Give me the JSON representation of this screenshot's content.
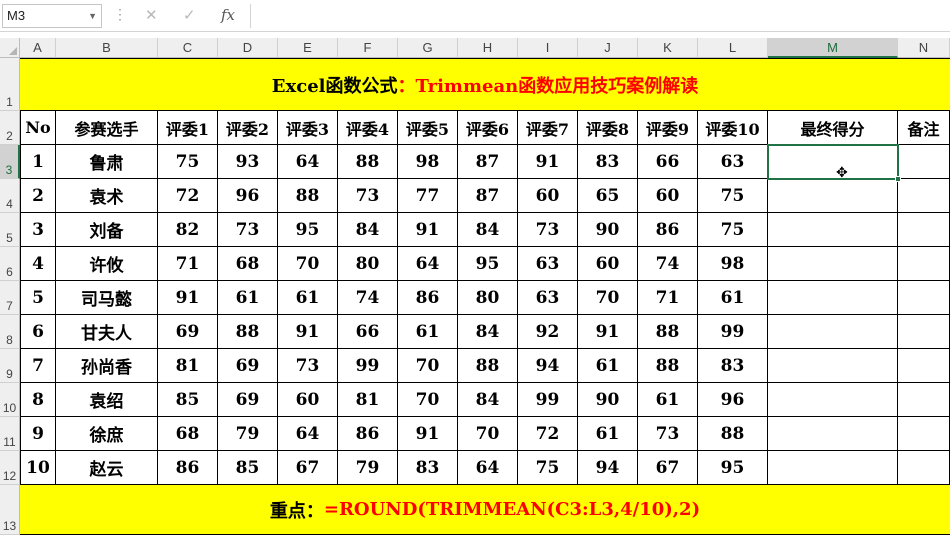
{
  "formula_bar": {
    "name_box": "M3",
    "name_box_arrow": "▼",
    "separator": "⋮",
    "cancel_icon": "✕",
    "enter_icon": "✓",
    "fx_label": "fx",
    "formula": ""
  },
  "columns": [
    "A",
    "B",
    "C",
    "D",
    "E",
    "F",
    "G",
    "H",
    "I",
    "J",
    "K",
    "L",
    "M",
    "N"
  ],
  "rows": [
    "1",
    "2",
    "3",
    "4",
    "5",
    "6",
    "7",
    "8",
    "9",
    "10",
    "11",
    "12",
    "13"
  ],
  "active_cell": "M3",
  "title": {
    "part1": "Excel函数公式",
    "part2": "：Trimmean函数应用技巧案例解读"
  },
  "table": {
    "headers": [
      "No",
      "参赛选手",
      "评委1",
      "评委2",
      "评委3",
      "评委4",
      "评委5",
      "评委6",
      "评委7",
      "评委8",
      "评委9",
      "评委10",
      "最终得分",
      "备注"
    ],
    "rows": [
      [
        "1",
        "鲁肃",
        "75",
        "93",
        "64",
        "88",
        "98",
        "87",
        "91",
        "83",
        "66",
        "63",
        "",
        ""
      ],
      [
        "2",
        "袁术",
        "72",
        "96",
        "88",
        "73",
        "77",
        "87",
        "60",
        "65",
        "60",
        "75",
        "",
        ""
      ],
      [
        "3",
        "刘备",
        "82",
        "73",
        "95",
        "84",
        "91",
        "84",
        "73",
        "90",
        "86",
        "75",
        "",
        ""
      ],
      [
        "4",
        "许攸",
        "71",
        "68",
        "70",
        "80",
        "64",
        "95",
        "63",
        "60",
        "74",
        "98",
        "",
        ""
      ],
      [
        "5",
        "司马懿",
        "91",
        "61",
        "61",
        "74",
        "86",
        "80",
        "63",
        "70",
        "71",
        "61",
        "",
        ""
      ],
      [
        "6",
        "甘夫人",
        "69",
        "88",
        "91",
        "66",
        "61",
        "84",
        "92",
        "91",
        "88",
        "99",
        "",
        ""
      ],
      [
        "7",
        "孙尚香",
        "81",
        "69",
        "73",
        "99",
        "70",
        "88",
        "94",
        "61",
        "88",
        "83",
        "",
        ""
      ],
      [
        "8",
        "袁绍",
        "85",
        "69",
        "60",
        "81",
        "70",
        "84",
        "99",
        "90",
        "61",
        "96",
        "",
        ""
      ],
      [
        "9",
        "徐庶",
        "68",
        "79",
        "64",
        "86",
        "91",
        "70",
        "72",
        "61",
        "73",
        "88",
        "",
        ""
      ],
      [
        "10",
        "赵云",
        "86",
        "85",
        "67",
        "79",
        "83",
        "64",
        "75",
        "94",
        "67",
        "95",
        "",
        ""
      ]
    ]
  },
  "footer": {
    "label": "重点：",
    "formula": "=ROUND(TRIMMEAN(C3:L3,4/10),2)"
  },
  "colors": {
    "banner_bg": "#ffff00",
    "accent_red": "#ff0000",
    "selection": "#217346"
  },
  "icons": {
    "cursor": "cross-cursor-icon"
  }
}
